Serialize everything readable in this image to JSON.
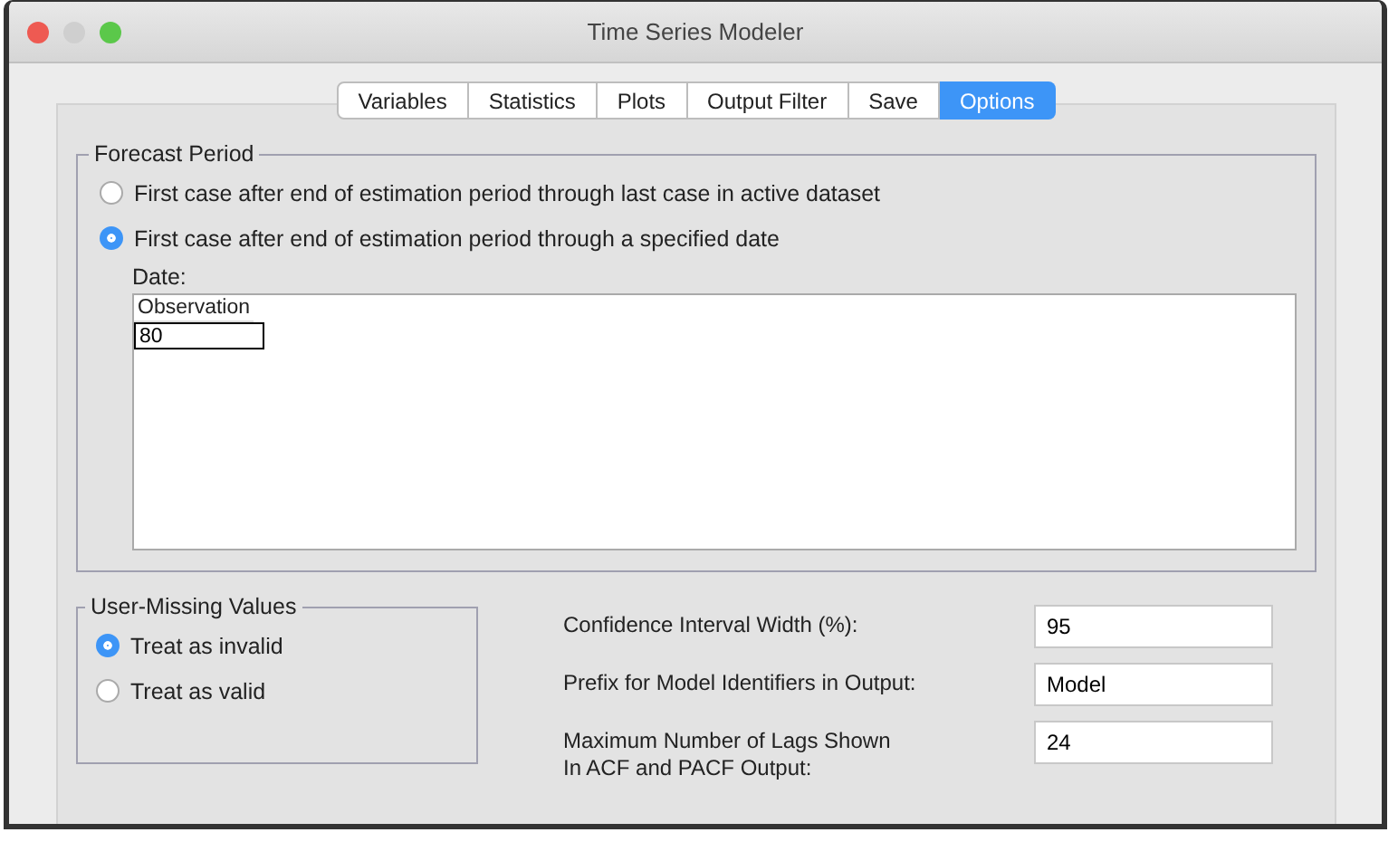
{
  "window": {
    "title": "Time Series Modeler"
  },
  "tabs": [
    {
      "label": "Variables",
      "selected": false
    },
    {
      "label": "Statistics",
      "selected": false
    },
    {
      "label": "Plots",
      "selected": false
    },
    {
      "label": "Output Filter",
      "selected": false
    },
    {
      "label": "Save",
      "selected": false
    },
    {
      "label": "Options",
      "selected": true
    }
  ],
  "forecast_period": {
    "title": "Forecast Period",
    "options": [
      {
        "label": "First case after end of estimation period through last case in active dataset",
        "selected": false
      },
      {
        "label": "First case after end of estimation period through a specified date",
        "selected": true
      }
    ],
    "date_label": "Date:",
    "table": {
      "columns": [
        "Observation"
      ],
      "value": "80"
    }
  },
  "user_missing": {
    "title": "User-Missing Values",
    "options": [
      {
        "label": "Treat as invalid",
        "selected": true
      },
      {
        "label": "Treat as valid",
        "selected": false
      }
    ]
  },
  "fields": [
    {
      "label": "Confidence Interval Width (%):",
      "value": "95"
    },
    {
      "label": "Prefix for Model Identifiers in Output:",
      "value": "Model"
    },
    {
      "label": "Maximum Number of Lags Shown\nIn ACF and PACF Output:",
      "value": "24"
    }
  ]
}
